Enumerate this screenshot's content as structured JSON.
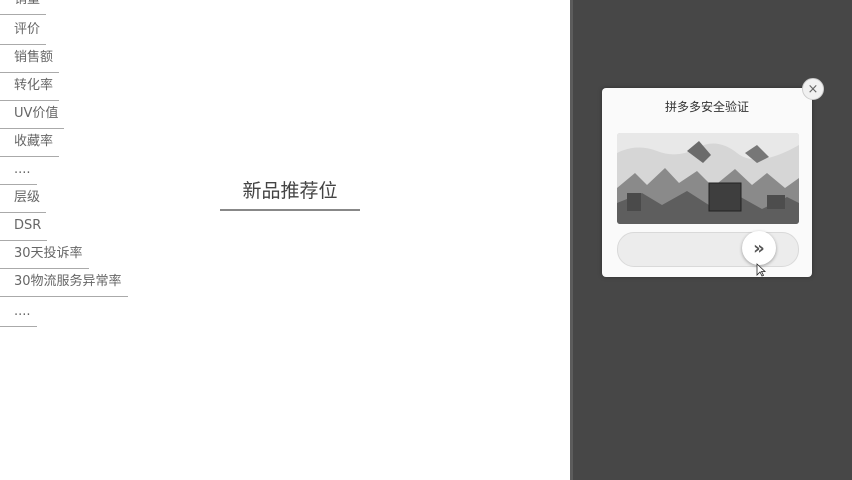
{
  "left_list": {
    "items": [
      "销量",
      "评价",
      "销售额",
      "转化率",
      "UV价值",
      "收藏率",
      "....",
      "层级",
      "DSR",
      "30天投诉率",
      "30物流服务异常率",
      "...."
    ]
  },
  "main": {
    "title": "新品推荐位"
  },
  "captcha": {
    "title": "拼多多安全验证",
    "close_icon": "close-icon",
    "refresh_icon": "refresh-icon",
    "slider_icon": "double-chevron-right-icon",
    "close_glyph": "×",
    "refresh_glyph": "↻",
    "slider_glyph": "»"
  },
  "colors": {
    "overlay": "#474747",
    "dialog": "#fafafa"
  }
}
